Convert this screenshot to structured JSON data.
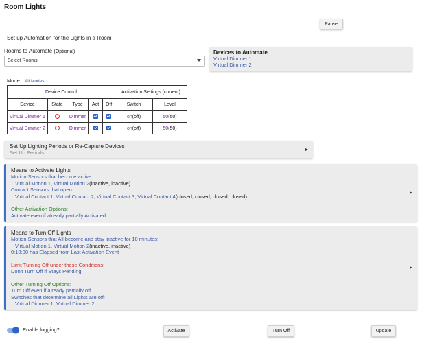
{
  "page": {
    "title": "Room Lights"
  },
  "buttons": {
    "pause": "Pause",
    "activate": "Activate",
    "turn_off": "Turn Off",
    "update": "Update"
  },
  "setup": {
    "heading": "Set up Automation for the Lights in a Room"
  },
  "rooms": {
    "label": "Rooms to Automate",
    "optional": "(Optional)",
    "placeholder": "Select Rooms"
  },
  "devices": {
    "header": "Devices to Automate",
    "items": [
      "Virtual Dimmer 1",
      "Virtual Dimmer 2"
    ]
  },
  "mode": {
    "label": "Mode:",
    "value": "All Modes"
  },
  "table": {
    "group_device_control": "Device Control",
    "group_activation": "Activation Settings (current)",
    "columns": [
      "Device",
      "State",
      "Type",
      "Act",
      "Off",
      "Switch",
      "Level"
    ],
    "rows": [
      {
        "device": "Virtual Dimmer 1",
        "type": "Dimmer",
        "switch_on": "on",
        "switch_cur": "(off)",
        "level": "50",
        "level_cur": "(50)"
      },
      {
        "device": "Virtual Dimmer 2",
        "type": "Dimmer",
        "switch_on": "on",
        "switch_cur": "(off)",
        "level": "50",
        "level_cur": "(50)"
      }
    ]
  },
  "periods": {
    "title": "Set Up Lighting Periods or Re-Capture Devices",
    "subtitle": "Set Up Periods"
  },
  "activate_panel": {
    "title": "Means to Activate Lights",
    "motion_label": "Motion Sensors that become active:",
    "motion_devices": "Virtual Motion 1, Virtual Motion 2",
    "motion_state": "(inactive, inactive)",
    "contact_label": "Contact Sensors that open:",
    "contact_devices": "Virtual Contact 1, Virtual Contact 2, Virtual Contact 3, Virtual Contact 4",
    "contact_state": "(closed, closed, closed, closed)",
    "other_label": "Other Activation Options:",
    "other_value": "Activate even if already partially Activated"
  },
  "off_panel": {
    "title": "Means to Turn Off Lights",
    "motion_label": "Motion Sensors that All become and stay inactive for 10 minutes:",
    "motion_devices": "Virtual Motion 1, Virtual Motion 2",
    "motion_state": "(inactive, inactive)",
    "elapsed": "0:10:00 has Elapsed from Last Activation Event",
    "limit_label": "Limit Turning Off under these Conditions:",
    "limit_value": "Don't Turn Off if Stays Pending",
    "other_label": "Other Turning Off Options:",
    "other_value": "Turn Off even if already partially off",
    "switches_label": "Switches that determine all Lights are off:",
    "switches_devices": "Virtual Dimmer 1, Virtual Dimmer 2"
  },
  "logging": {
    "label": "Enable logging?",
    "enabled": true
  },
  "colors": {
    "accent": "#3f6fc7",
    "link": "#3b5aa8",
    "purple": "#7b1fa2",
    "green": "#2e7d32",
    "red": "#d32f2f"
  }
}
